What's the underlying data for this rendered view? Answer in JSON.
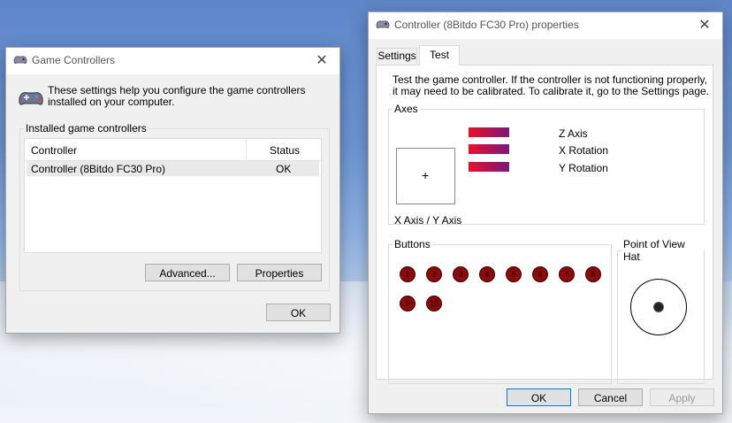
{
  "game_controllers": {
    "title": "Game Controllers",
    "description": "These settings help you configure the game controllers installed on your computer.",
    "group_label": "Installed game controllers",
    "columns": [
      "Controller",
      "Status"
    ],
    "rows": [
      {
        "controller": "Controller (8Bitdo FC30 Pro)",
        "status": "OK"
      }
    ],
    "advanced_label": "Advanced...",
    "properties_label": "Properties",
    "ok_label": "OK",
    "close_glyph": "✕"
  },
  "properties": {
    "title": "Controller (8Bitdo FC30 Pro) properties",
    "close_glyph": "✕",
    "tabs": [
      {
        "label": "Settings",
        "active": false
      },
      {
        "label": "Test",
        "active": true
      }
    ],
    "intro": "Test the game controller.  If the controller is not functioning properly, it may need to be calibrated.  To calibrate it, go to the Settings page.",
    "axes_label": "Axes",
    "xy_label": "X Axis / Y Axis",
    "crosshair": "+",
    "axis_names": [
      "Z Axis",
      "X Rotation",
      "Y Rotation"
    ],
    "buttons_label": "Buttons",
    "buttons": [
      "1",
      "2",
      "3",
      "4",
      "5",
      "6",
      "7",
      "8",
      "9",
      "10"
    ],
    "pov_label": "Point of View Hat",
    "ok_label": "OK",
    "cancel_label": "Cancel",
    "apply_label": "Apply"
  },
  "colors": {
    "axis_bar_start": "#e8102b",
    "axis_bar_end": "#7a1a7a",
    "button_fill": "#8b0a0a",
    "focus_border": "#0078d7"
  },
  "icons": [
    "gamepad-icon",
    "close-icon"
  ]
}
